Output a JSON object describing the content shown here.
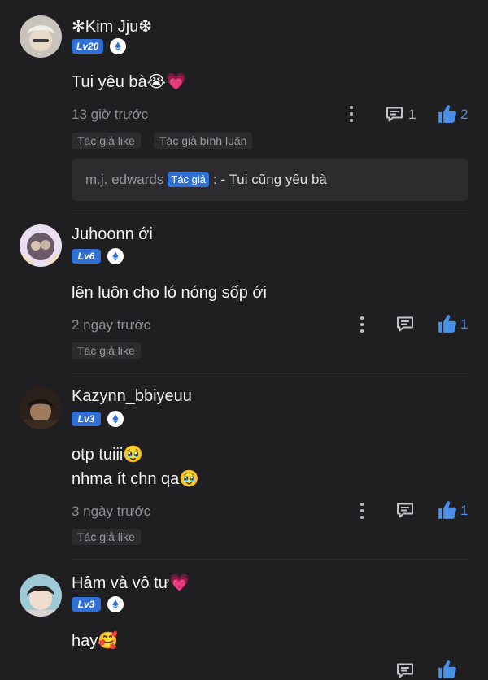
{
  "colors": {
    "accent": "#4a8fe8",
    "level_badge": "#2f6fd6",
    "background": "#1f1f21"
  },
  "comments": [
    {
      "username": "✻Kim Jju❆",
      "level": "Lv20",
      "text_lines": [
        "Tui yêu bà😭💗"
      ],
      "time": "13 giờ trước",
      "reply_count": "1",
      "like_count": "2",
      "tags": [
        "Tác giả like",
        "Tác giả bình luận"
      ],
      "reply": {
        "author": "m.j. edwards",
        "badge": "Tác giả",
        "text": ": - Tui cũng yêu bà"
      }
    },
    {
      "username": "Juhoonn ới",
      "level": "Lv6",
      "text_lines": [
        "lên luôn cho ló nóng sốp ới"
      ],
      "time": "2 ngày trước",
      "reply_count": "",
      "like_count": "1",
      "tags": [
        "Tác giả like"
      ]
    },
    {
      "username": "Kazynn_bbiyeuu",
      "level": "Lv3",
      "text_lines": [
        "otp tuiii🥹",
        "nhma ít chn qa🥹"
      ],
      "time": "3 ngày trước",
      "reply_count": "",
      "like_count": "1",
      "tags": [
        "Tác giả like"
      ]
    },
    {
      "username": "Hâm và vô tư💗",
      "level": "Lv3",
      "text_lines": [
        "hay🥰"
      ],
      "time": "",
      "reply_count": "",
      "like_count": "",
      "tags": []
    }
  ]
}
